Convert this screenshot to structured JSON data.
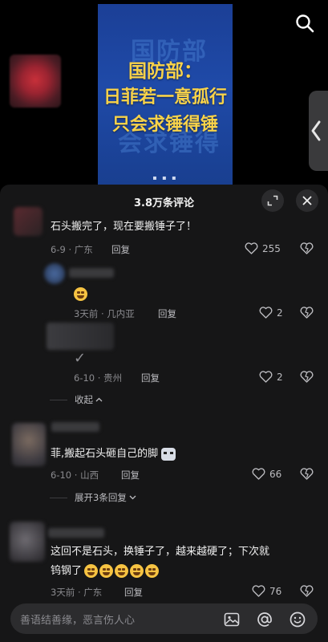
{
  "video": {
    "headline_line1": "国防部：",
    "headline_line2": "日菲若一意孤行",
    "headline_line3": "只会求锤得锤",
    "icons": [
      "search-icon",
      "chevron-left-icon"
    ]
  },
  "comments_panel": {
    "title": "3.8万条评论",
    "comments": [
      {
        "text": "石头搬完了，现在要搬锤子了！",
        "date": "6-9",
        "location": "广东",
        "reply_label": "回复",
        "likes": "255"
      },
      {
        "emoji": "grinning-face",
        "date": "3天前",
        "location": "几内亚",
        "reply_label": "回复",
        "likes": "2"
      },
      {
        "checkmark": "✓",
        "date": "6-10",
        "location": "贵州",
        "reply_label": "回复",
        "likes": "2"
      },
      {
        "text": "菲,搬起石头砸自己的脚",
        "date": "6-10",
        "location": "山西",
        "reply_label": "回复",
        "likes": "66"
      },
      {
        "text_line1": "这回不是石头，换锤子了，越来越硬了；下次就",
        "text_line2": "钨钢了",
        "date": "3天前",
        "location": "广东",
        "reply_label": "回复",
        "likes": "76"
      }
    ],
    "collapse_label": "收起",
    "expand_label": "展开3条回复"
  },
  "input": {
    "placeholder": "善语结善缘，恶言伤人心",
    "icons": [
      "image-icon",
      "at-icon",
      "emoji-icon"
    ]
  },
  "colors": {
    "panel_bg": "#161617",
    "headline": "#f7d24a",
    "thumb_bg": "#1f4aa8"
  }
}
